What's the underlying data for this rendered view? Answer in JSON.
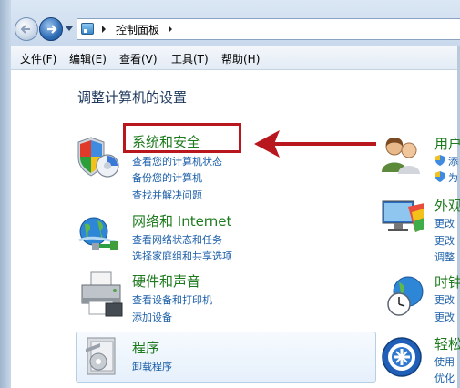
{
  "address": {
    "path_item": "控制面板"
  },
  "menu": {
    "file": "文件(F)",
    "edit": "编辑(E)",
    "view": "查看(V)",
    "tools": "工具(T)",
    "help": "帮助(H)"
  },
  "page_title": "调整计算机的设置",
  "categories": [
    {
      "title": "系统和安全",
      "links": [
        "查看您的计算机状态",
        "备份您的计算机",
        "查找并解决问题"
      ]
    },
    {
      "title": "网络和 Internet",
      "links": [
        "查看网络状态和任务",
        "选择家庭组和共享选项"
      ]
    },
    {
      "title": "硬件和声音",
      "links": [
        "查看设备和打印机",
        "添加设备"
      ]
    },
    {
      "title": "程序",
      "links": [
        "卸载程序"
      ]
    }
  ],
  "right_categories": [
    {
      "title": "用户",
      "links": [
        "添",
        "为"
      ]
    },
    {
      "title": "外观",
      "links": [
        "更改",
        "更改",
        "调整"
      ]
    },
    {
      "title": "时钟",
      "links": [
        "更改",
        "更改"
      ]
    },
    {
      "title": "轻松",
      "links": [
        "使用",
        "优化"
      ]
    }
  ],
  "colors": {
    "highlight": "#b8171d",
    "category_title": "#1d7a1d",
    "link": "#1a5ea8",
    "title": "#1e395b"
  }
}
